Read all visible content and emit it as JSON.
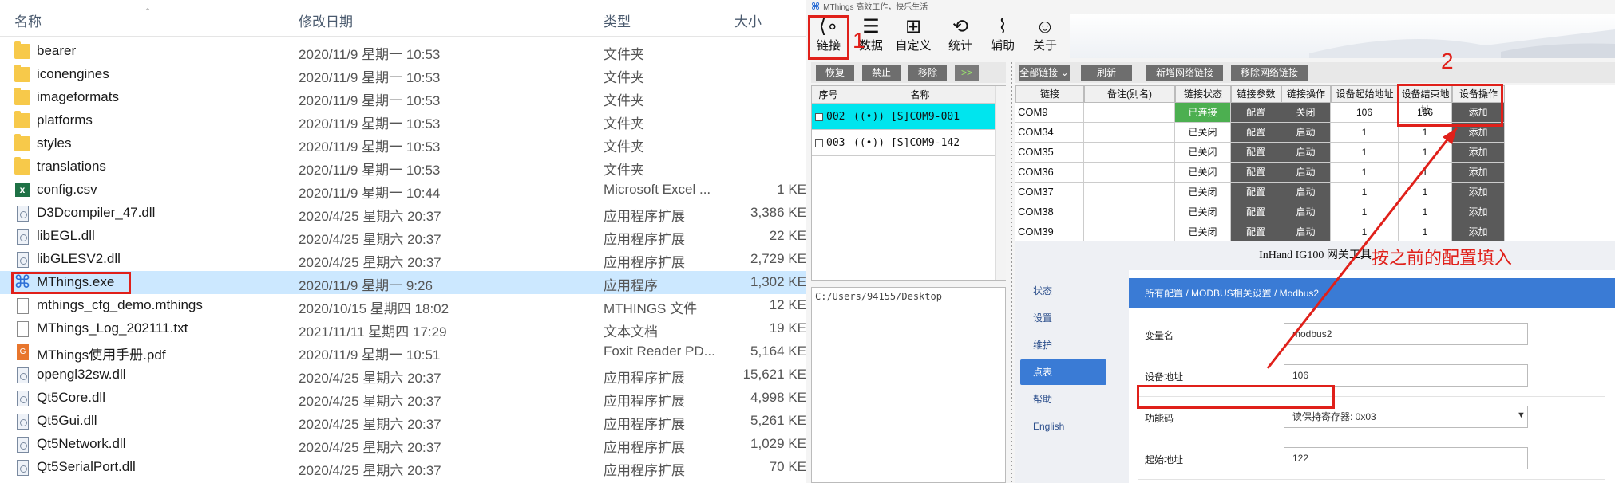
{
  "explorer": {
    "headers": {
      "name": "名称",
      "date": "修改日期",
      "type": "类型",
      "size": "大小"
    },
    "files": [
      {
        "icon": "folder-icon",
        "name": "bearer",
        "date": "2020/11/9 星期一 10:53",
        "type": "文件夹",
        "size": ""
      },
      {
        "icon": "folder-icon",
        "name": "iconengines",
        "date": "2020/11/9 星期一 10:53",
        "type": "文件夹",
        "size": ""
      },
      {
        "icon": "folder-icon",
        "name": "imageformats",
        "date": "2020/11/9 星期一 10:53",
        "type": "文件夹",
        "size": ""
      },
      {
        "icon": "folder-icon",
        "name": "platforms",
        "date": "2020/11/9 星期一 10:53",
        "type": "文件夹",
        "size": ""
      },
      {
        "icon": "folder-icon",
        "name": "styles",
        "date": "2020/11/9 星期一 10:53",
        "type": "文件夹",
        "size": ""
      },
      {
        "icon": "folder-icon",
        "name": "translations",
        "date": "2020/11/9 星期一 10:53",
        "type": "文件夹",
        "size": ""
      },
      {
        "icon": "excel-icon",
        "name": "config.csv",
        "date": "2020/11/9 星期一 10:44",
        "type": "Microsoft Excel ...",
        "size": "1 KE"
      },
      {
        "icon": "dll-icon",
        "name": "D3Dcompiler_47.dll",
        "date": "2020/4/25 星期六 20:37",
        "type": "应用程序扩展",
        "size": "3,386 KE"
      },
      {
        "icon": "dll-icon",
        "name": "libEGL.dll",
        "date": "2020/4/25 星期六 20:37",
        "type": "应用程序扩展",
        "size": "22 KE"
      },
      {
        "icon": "dll-icon",
        "name": "libGLESV2.dll",
        "date": "2020/4/25 星期六 20:37",
        "type": "应用程序扩展",
        "size": "2,729 KE"
      },
      {
        "icon": "mthings-exe-icon",
        "name": "MThings.exe",
        "date": "2020/11/9 星期一 9:26",
        "type": "应用程序",
        "size": "1,302 KE"
      },
      {
        "icon": "file-icon",
        "name": "mthings_cfg_demo.mthings",
        "date": "2020/10/15 星期四 18:02",
        "type": "MTHINGS 文件",
        "size": "12 KE"
      },
      {
        "icon": "text-icon",
        "name": "MThings_Log_202111.txt",
        "date": "2021/11/11 星期四 17:29",
        "type": "文本文档",
        "size": "19 KE"
      },
      {
        "icon": "pdf-icon",
        "name": "MThings使用手册.pdf",
        "date": "2020/11/9 星期一 10:51",
        "type": "Foxit Reader PD...",
        "size": "5,164 KE"
      },
      {
        "icon": "dll-icon",
        "name": "opengl32sw.dll",
        "date": "2020/4/25 星期六 20:37",
        "type": "应用程序扩展",
        "size": "15,621 KE"
      },
      {
        "icon": "dll-icon",
        "name": "Qt5Core.dll",
        "date": "2020/4/25 星期六 20:37",
        "type": "应用程序扩展",
        "size": "4,998 KE"
      },
      {
        "icon": "dll-icon",
        "name": "Qt5Gui.dll",
        "date": "2020/4/25 星期六 20:37",
        "type": "应用程序扩展",
        "size": "5,261 KE"
      },
      {
        "icon": "dll-icon",
        "name": "Qt5Network.dll",
        "date": "2020/4/25 星期六 20:37",
        "type": "应用程序扩展",
        "size": "1,029 KE"
      },
      {
        "icon": "dll-icon",
        "name": "Qt5SerialPort.dll",
        "date": "2020/4/25 星期六 20:37",
        "type": "应用程序扩展",
        "size": "70 KE"
      }
    ]
  },
  "mthings": {
    "title": "MThings  高效工作，快乐生活",
    "toolbar": [
      {
        "label": "链接",
        "icon": "share-icon"
      },
      {
        "label": "数据",
        "icon": "list-icon"
      },
      {
        "label": "自定义",
        "icon": "grid-list-icon"
      },
      {
        "label": "统计",
        "icon": "history-icon"
      },
      {
        "label": "辅助",
        "icon": "paperclip-icon"
      },
      {
        "label": "关于",
        "icon": "user-icon"
      }
    ],
    "left_buttons": [
      "恢复",
      "禁止",
      "移除",
      ">>"
    ],
    "right_buttons": [
      "全部链接 ⌄",
      "刷新",
      "新增网络链接",
      "移除网络链接"
    ],
    "link_list": {
      "headers": [
        "序号",
        "名称"
      ],
      "rows": [
        {
          "id": "002",
          "name": "((•)) [S]COM9-001"
        },
        {
          "id": "003",
          "name": "((•)) [S]COM9-142"
        }
      ]
    },
    "path": "C:/Users/94155/Desktop",
    "grid": {
      "headers": [
        "链接",
        "备注(别名)",
        "链接状态",
        "链接参数",
        "链接操作",
        "设备起始地址",
        "设备结束地址",
        "设备操作"
      ],
      "rows": [
        {
          "link": "COM9",
          "note": "",
          "status": "已连接",
          "param": "配置",
          "op": "关闭",
          "start": "106",
          "end": "106",
          "dev": "添加"
        },
        {
          "link": "COM34",
          "note": "",
          "status": "已关闭",
          "param": "配置",
          "op": "启动",
          "start": "1",
          "end": "1",
          "dev": "添加"
        },
        {
          "link": "COM35",
          "note": "",
          "status": "已关闭",
          "param": "配置",
          "op": "启动",
          "start": "1",
          "end": "1",
          "dev": "添加"
        },
        {
          "link": "COM36",
          "note": "",
          "status": "已关闭",
          "param": "配置",
          "op": "启动",
          "start": "1",
          "end": "1",
          "dev": "添加"
        },
        {
          "link": "COM37",
          "note": "",
          "status": "已关闭",
          "param": "配置",
          "op": "启动",
          "start": "1",
          "end": "1",
          "dev": "添加"
        },
        {
          "link": "COM38",
          "note": "",
          "status": "已关闭",
          "param": "配置",
          "op": "启动",
          "start": "1",
          "end": "1",
          "dev": "添加"
        },
        {
          "link": "COM39",
          "note": "",
          "status": "已关闭",
          "param": "配置",
          "op": "启动",
          "start": "1",
          "end": "1",
          "dev": "添加"
        }
      ]
    }
  },
  "router": {
    "title": "InHand IG100 网关工具",
    "sidebar": [
      "状态",
      "设置",
      "维护",
      "点表",
      "帮助",
      "English"
    ],
    "breadcrumb": "所有配置 / MODBUS相关设置 / Modbus2",
    "form": [
      {
        "label": "变量名",
        "value": "modbus2"
      },
      {
        "label": "设备地址",
        "value": "106"
      },
      {
        "label": "功能码",
        "value": "读保持寄存器: 0x03"
      },
      {
        "label": "起始地址",
        "value": "122"
      }
    ]
  },
  "annotations": {
    "step1": "1",
    "step2": "2",
    "note": "按之前的配置填入"
  }
}
